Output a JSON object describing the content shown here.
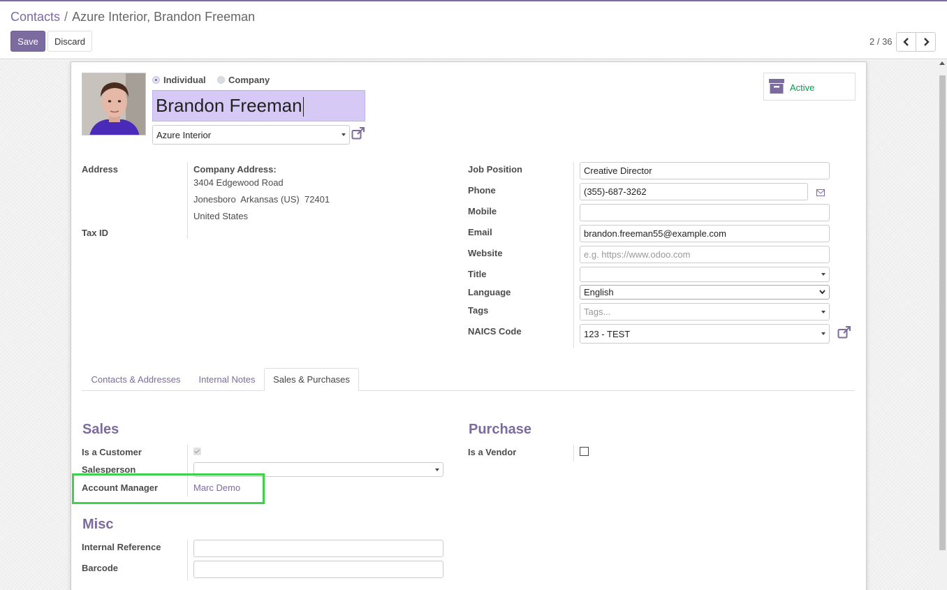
{
  "breadcrumb": {
    "parent": "Contacts",
    "separator": "/",
    "current": "Azure Interior, Brandon Freeman"
  },
  "buttons": {
    "save": "Save",
    "discard": "Discard"
  },
  "pager": {
    "value": "2 / 36"
  },
  "header": {
    "type_options": [
      "Individual",
      "Company"
    ],
    "selected_type": "Individual",
    "name": "Brandon Freeman",
    "company": "Azure Interior",
    "active_label": "Active"
  },
  "address": {
    "label": "Address",
    "company_heading": "Company Address:",
    "street": "3404 Edgewood Road",
    "city_line": "Jonesboro  Arkansas (US)  72401",
    "country": "United States",
    "tax_label": "Tax ID"
  },
  "contact_fields": {
    "job_position": {
      "label": "Job Position",
      "value": "Creative Director"
    },
    "phone": {
      "label": "Phone",
      "value": "(355)-687-3262"
    },
    "mobile": {
      "label": "Mobile",
      "value": ""
    },
    "email": {
      "label": "Email",
      "value": "brandon.freeman55@example.com"
    },
    "website": {
      "label": "Website",
      "placeholder": "e.g. https://www.odoo.com"
    },
    "title": {
      "label": "Title",
      "value": ""
    },
    "language": {
      "label": "Language",
      "value": "English"
    },
    "tags": {
      "label": "Tags",
      "placeholder": "Tags..."
    },
    "naics": {
      "label": "NAICS Code",
      "value": "123 - TEST"
    }
  },
  "tabs": [
    {
      "label": "Contacts & Addresses",
      "active": false
    },
    {
      "label": "Internal Notes",
      "active": false
    },
    {
      "label": "Sales & Purchases",
      "active": true
    }
  ],
  "sales": {
    "title": "Sales",
    "is_customer_label": "Is a Customer",
    "is_customer": true,
    "salesperson_label": "Salesperson",
    "salesperson": "",
    "account_manager_label": "Account Manager",
    "account_manager": "Marc Demo"
  },
  "purchase": {
    "title": "Purchase",
    "is_vendor_label": "Is a Vendor",
    "is_vendor": false
  },
  "misc": {
    "title": "Misc",
    "internal_ref_label": "Internal Reference",
    "internal_ref": "",
    "barcode_label": "Barcode",
    "barcode": ""
  },
  "colors": {
    "brand": "#7c6b9e",
    "active_green": "#00a04a",
    "highlight": "#3ed14a",
    "name_field": "#d6c9f5"
  }
}
